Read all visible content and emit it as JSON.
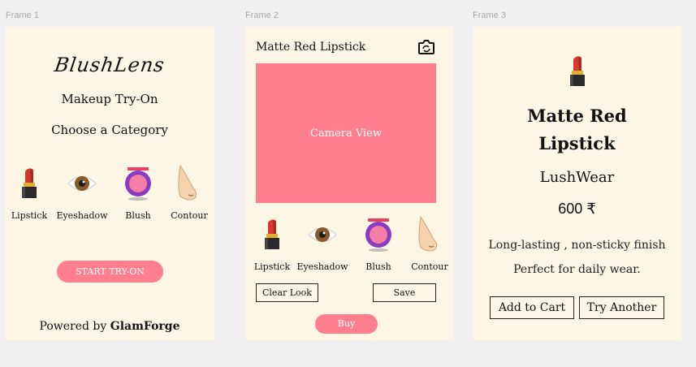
{
  "frames": {
    "f1_label": "Frame 1",
    "f2_label": "Frame 2",
    "f3_label": "Frame 3"
  },
  "frame1": {
    "logo": "BlushLens",
    "subtitle": "Makeup Try-On",
    "prompt": "Choose a Category",
    "categories": [
      {
        "label": "Lipstick",
        "icon": "lipstick-icon"
      },
      {
        "label": "Eyeshadow",
        "icon": "eye-icon"
      },
      {
        "label": "Blush",
        "icon": "blush-compact-icon"
      },
      {
        "label": "Contour",
        "icon": "nose-icon"
      }
    ],
    "start_button": "START TRY-ON",
    "powered_prefix": "Powered by",
    "powered_brand": "GlamForge"
  },
  "frame2": {
    "title": "Matte Red Lipstick",
    "camera_icon": "camera-switch-icon",
    "camera_view": "Camera View",
    "categories": [
      {
        "label": "Lipstick",
        "icon": "lipstick-icon"
      },
      {
        "label": "Eyeshadow",
        "icon": "eye-icon"
      },
      {
        "label": "Blush",
        "icon": "blush-compact-icon"
      },
      {
        "label": "Contour",
        "icon": "nose-icon"
      }
    ],
    "clear_button": "Clear Look",
    "save_button": "Save",
    "buy_button": "Buy"
  },
  "frame3": {
    "product_icon": "lipstick-icon",
    "product_line1": "Matte Red",
    "product_line2": "Lipstick",
    "brand": "LushWear",
    "price": "600 ₹",
    "desc1": "Long-lasting , non-sticky finish",
    "desc2": "Perfect for daily wear.",
    "add_to_cart": "Add to Cart",
    "try_another": "Try Another"
  },
  "colors": {
    "accent_pink": "#ff7f8f",
    "frame_bg": "#fdf6e4",
    "canvas_bg": "#f0f0f0"
  }
}
